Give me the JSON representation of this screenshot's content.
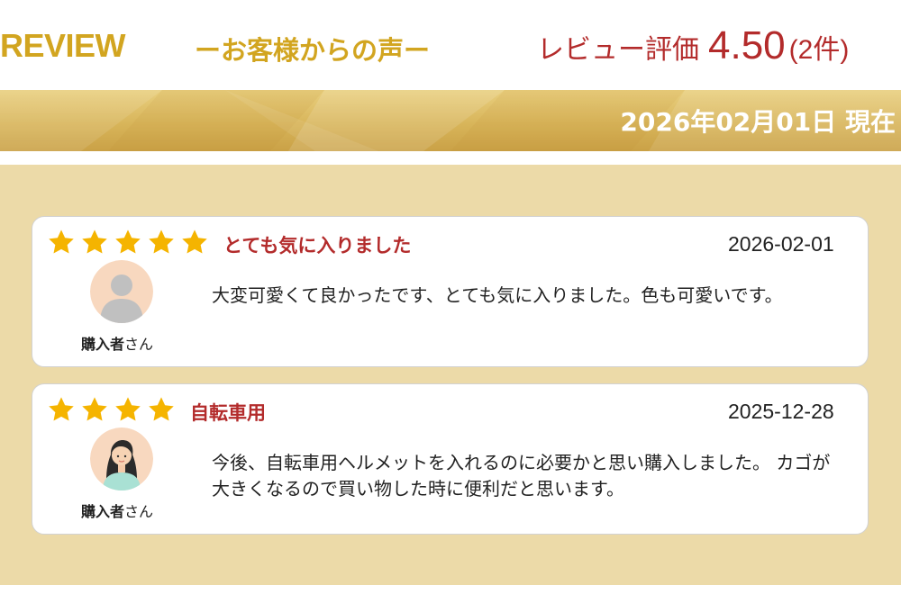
{
  "header": {
    "brand": "REVIEW",
    "subtitle": "ーお客様からの声ー",
    "rating_label": "レビュー評価",
    "rating_value": "4.50",
    "rating_count": "(2件)"
  },
  "banner": {
    "date_text": "2026年02月01日 現在"
  },
  "colors": {
    "gold": "#d2a520",
    "red": "#b32b2b",
    "panel": "#ecdaa8",
    "star": "#f5b400"
  },
  "reviews": [
    {
      "stars": 5,
      "title": "とても気に入りました",
      "date": "2026-02-01",
      "reviewer_name": "購入者",
      "reviewer_suffix": "さん",
      "avatar_icon": "default-user-avatar-icon",
      "body": "大変可愛くて良かったです、とても気に入りました。色も可愛いです。"
    },
    {
      "stars": 4,
      "title": "自転車用",
      "date": "2025-12-28",
      "reviewer_name": "購入者",
      "reviewer_suffix": "さん",
      "avatar_icon": "woman-avatar-icon",
      "body": "今後、自転車用ヘルメットを入れるのに必要かと思い購入しました。 カゴが大きくなるので買い物した時に便利だと思います。"
    }
  ]
}
